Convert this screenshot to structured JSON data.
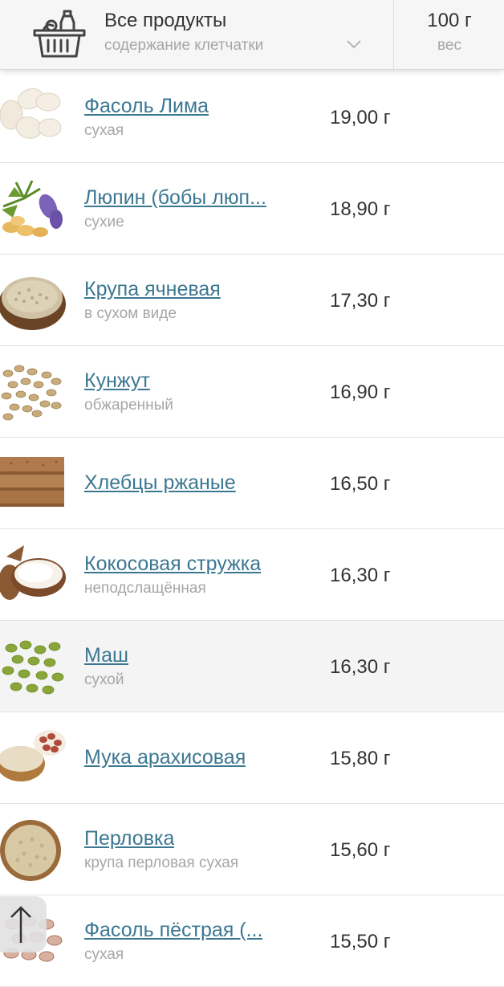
{
  "header": {
    "category_title": "Все продукты",
    "category_subtitle": "содержание клетчатки",
    "weight_value": "100 г",
    "weight_label": "вес"
  },
  "products": [
    {
      "name": "Фасоль Лима",
      "description": "сухая",
      "amount": "19,00 г",
      "image": "lima-beans-image"
    },
    {
      "name": "Люпин (бобы люп...",
      "description": "сухие",
      "amount": "18,90 г",
      "image": "lupin-image"
    },
    {
      "name": "Крупа ячневая",
      "description": "в сухом виде",
      "amount": "17,30 г",
      "image": "barley-grits-image"
    },
    {
      "name": "Кунжут",
      "description": "обжаренный",
      "amount": "16,90 г",
      "image": "sesame-image"
    },
    {
      "name": "Хлебцы ржаные",
      "description": "",
      "amount": "16,50 г",
      "image": "rye-crispbread-image"
    },
    {
      "name": "Кокосовая стружка",
      "description": "неподслащённая",
      "amount": "16,30 г",
      "image": "coconut-image"
    },
    {
      "name": "Маш",
      "description": "сухой",
      "amount": "16,30 г",
      "image": "mung-beans-image"
    },
    {
      "name": "Мука арахисовая",
      "description": "",
      "amount": "15,80 г",
      "image": "peanut-flour-image"
    },
    {
      "name": "Перловка",
      "description": "крупа перловая сухая",
      "amount": "15,60 г",
      "image": "pearl-barley-image"
    },
    {
      "name": "Фасоль пёстрая (...",
      "description": "сухая",
      "amount": "15,50 г",
      "image": "pinto-beans-image"
    }
  ],
  "colors": {
    "link": "#3c7792",
    "text": "#333333",
    "muted": "#a6a6a6",
    "header_bg": "#f6f6f6",
    "highlight_row": "#f4f4f4"
  },
  "icons": {
    "header_left": "basket-icon",
    "dropdown": "chevron-down-icon",
    "scroll_top": "arrow-up-icon"
  }
}
